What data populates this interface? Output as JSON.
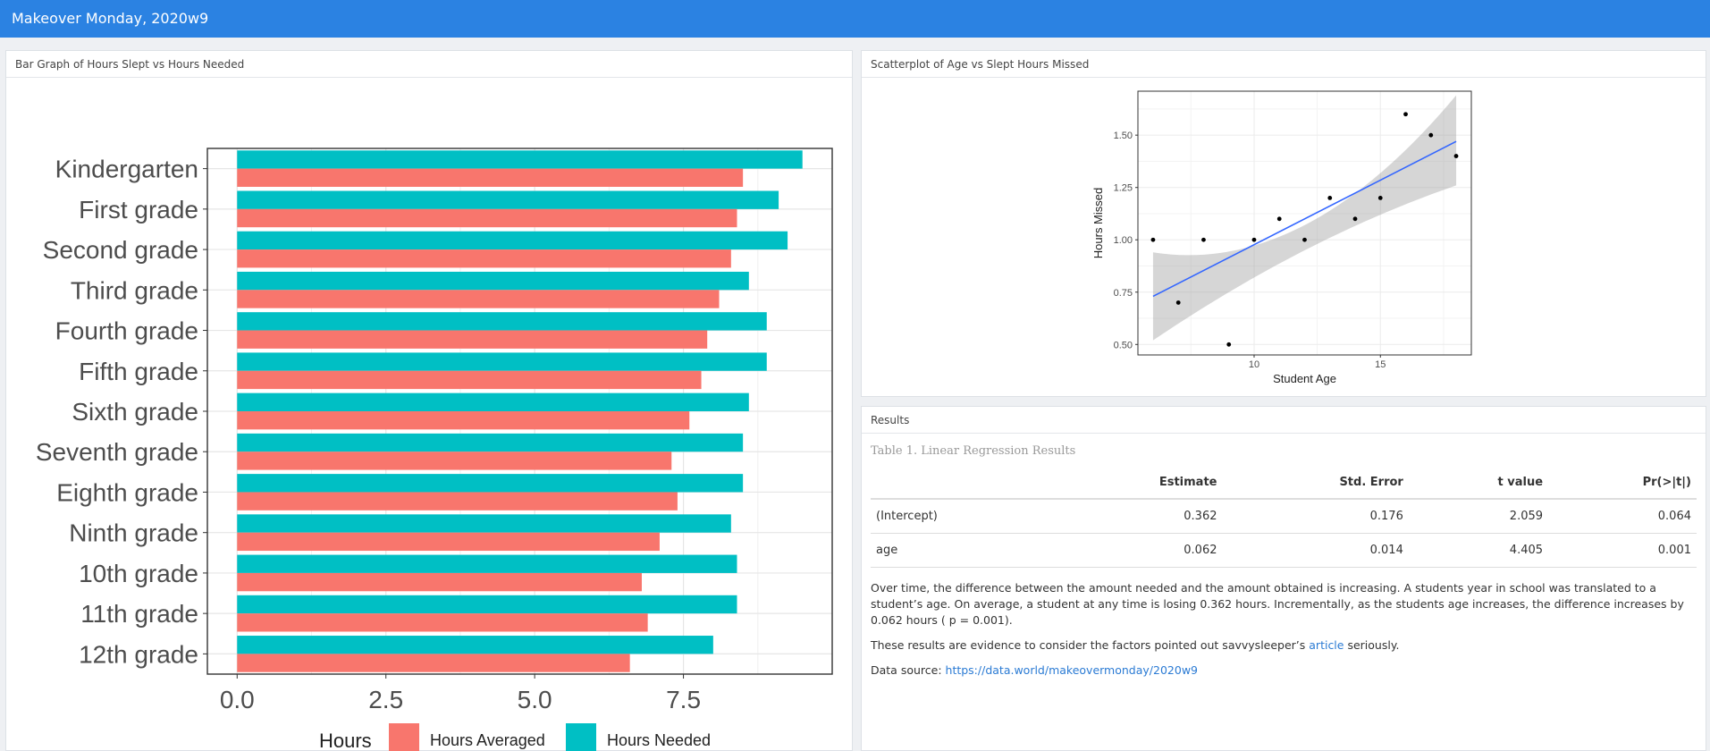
{
  "navbar": {
    "title": "Makeover Monday, 2020w9"
  },
  "panels": {
    "bar_title": "Bar Graph of Hours Slept vs Hours Needed",
    "scatter_title": "Scatterplot of Age vs Slept Hours Missed",
    "results_title": "Results"
  },
  "results": {
    "caption": "Table 1. Linear Regression Results",
    "headers": [
      "",
      "Estimate",
      "Std. Error",
      "t value",
      "Pr(>|t|)"
    ],
    "rows": [
      [
        "(Intercept)",
        "0.362",
        "0.176",
        "2.059",
        "0.064"
      ],
      [
        "age",
        "0.062",
        "0.014",
        "4.405",
        "0.001"
      ]
    ],
    "para1": "Over time, the difference between the amount needed and the amount obtained is increasing. A students year in school was translated to a student’s age. On average, a student at any time is losing 0.362 hours. Incrementally, as the students age increases, the difference increases by 0.062 hours ( p = 0.001).",
    "para2_before": "These results are evidence to consider the factors pointed out savvysleeper’s ",
    "para2_link": "article",
    "para2_after": " seriously.",
    "source_label": "Data source: ",
    "source_link": "https://data.world/makeovermonday/2020w9"
  },
  "chart_data": [
    {
      "type": "bar",
      "orientation": "horizontal",
      "categories": [
        "Kindergarten",
        "First grade",
        "Second grade",
        "Third grade",
        "Fourth grade",
        "Fifth grade",
        "Sixth grade",
        "Seventh grade",
        "Eighth grade",
        "Ninth grade",
        "10th grade",
        "11th grade",
        "12th grade"
      ],
      "series": [
        {
          "name": "Hours Needed",
          "color": "#00bfc4",
          "values": [
            9.5,
            9.1,
            9.25,
            8.6,
            8.9,
            8.9,
            8.6,
            8.5,
            8.5,
            8.3,
            8.4,
            8.4,
            8.0
          ]
        },
        {
          "name": "Hours Averaged",
          "color": "#f8766d",
          "values": [
            8.5,
            8.4,
            8.3,
            8.1,
            7.9,
            7.8,
            7.6,
            7.3,
            7.4,
            7.1,
            6.8,
            6.9,
            6.6
          ]
        }
      ],
      "xticks": [
        "0.0",
        "2.5",
        "5.0",
        "7.5"
      ],
      "xlim": [
        -0.5,
        10
      ],
      "legend_title": "Hours",
      "legend_order": [
        "Hours Averaged",
        "Hours Needed"
      ],
      "legend_position": "bottom",
      "grid": true
    },
    {
      "type": "scatter",
      "points": [
        {
          "x": 6,
          "y": 1.0
        },
        {
          "x": 7,
          "y": 0.7
        },
        {
          "x": 8,
          "y": 1.0
        },
        {
          "x": 9,
          "y": 0.5
        },
        {
          "x": 10,
          "y": 1.0
        },
        {
          "x": 11,
          "y": 1.1
        },
        {
          "x": 12,
          "y": 1.0
        },
        {
          "x": 13,
          "y": 1.2
        },
        {
          "x": 14,
          "y": 1.1
        },
        {
          "x": 15,
          "y": 1.2
        },
        {
          "x": 16,
          "y": 1.6
        },
        {
          "x": 17,
          "y": 1.5
        },
        {
          "x": 18,
          "y": 1.4
        }
      ],
      "fit": {
        "x": [
          6,
          18
        ],
        "y": [
          0.73,
          1.47
        ],
        "color": "#3366ff"
      },
      "band": {
        "x": [
          6,
          12,
          18
        ],
        "lower": [
          0.52,
          0.95,
          1.26
        ],
        "upper": [
          0.94,
          1.07,
          1.69
        ]
      },
      "xlabel": "Student Age",
      "ylabel": "Hours Missed",
      "xticks": [
        "10",
        "15"
      ],
      "yticks": [
        "0.50",
        "0.75",
        "1.00",
        "1.25",
        "1.50"
      ],
      "xlim": [
        5.4,
        18.6
      ],
      "ylim": [
        0.45,
        1.71
      ],
      "grid": true
    }
  ]
}
